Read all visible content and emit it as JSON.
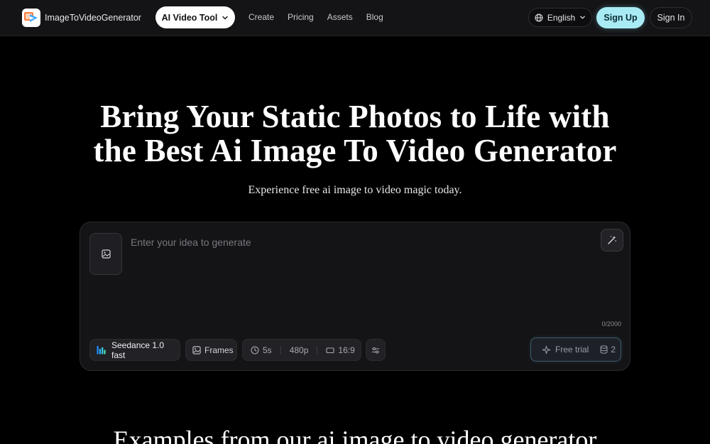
{
  "header": {
    "brand": "ImageToVideoGenerator",
    "tool_button": "AI Video Tool",
    "nav": [
      "Create",
      "Pricing",
      "Assets",
      "Blog"
    ],
    "language": "English",
    "signup": "Sign Up",
    "signin": "Sign In"
  },
  "hero": {
    "title_line1": "Bring Your Static Photos to Life with",
    "title_line2": "the Best Ai Image To Video Generator",
    "subtitle": "Experience free ai image to video magic today."
  },
  "generator": {
    "placeholder": "Enter your idea to generate",
    "counter": "0/2000",
    "model": "Seedance 1.0 fast",
    "frames": "Frames",
    "duration": "5s",
    "resolution": "480p",
    "ratio": "16:9",
    "trial": "Free trial",
    "credits": "2"
  },
  "examples": {
    "title": "Examples from our ai image to video generator"
  },
  "icons": {
    "logo": "logo-icon",
    "chevron": "chevron-down-icon",
    "globe": "globe-icon",
    "image": "image-icon",
    "magic": "magic-wand-icon",
    "model": "bars-icon",
    "clock": "clock-icon",
    "ratio": "aspect-ratio-icon",
    "settings": "sliders-icon",
    "sparkle": "sparkle-icon",
    "credits": "database-icon"
  },
  "colors": {
    "accent": "#a8ebf5",
    "background": "#000000",
    "header": "#141416",
    "card": "#141416"
  }
}
